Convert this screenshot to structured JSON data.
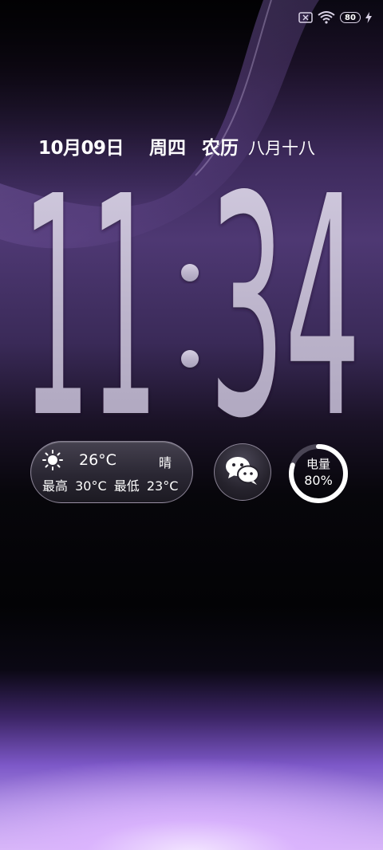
{
  "status_bar": {
    "sim_icon": "no-sim-icon",
    "wifi_icon": "wifi-icon",
    "battery_level": "80",
    "charging_icon": "charging-bolt-icon"
  },
  "date": {
    "date": "10月09日",
    "weekday": "周四",
    "lunar_label": "农历",
    "lunar_date": "八月十八"
  },
  "clock": {
    "hour": "11",
    "minute": "34"
  },
  "weather": {
    "icon": "sun-icon",
    "temperature": "26°C",
    "condition": "晴",
    "high_label": "最高",
    "high": "30°C",
    "low_label": "最低",
    "low": "23°C"
  },
  "wechat": {
    "icon": "wechat-icon"
  },
  "battery": {
    "label": "电量",
    "percent_text": "80%",
    "level": 0.8
  },
  "colors": {
    "accent_purple": "#4e3873",
    "glow_lavender": "#d4b8f3",
    "clock_digit": "#c9c2d6"
  }
}
